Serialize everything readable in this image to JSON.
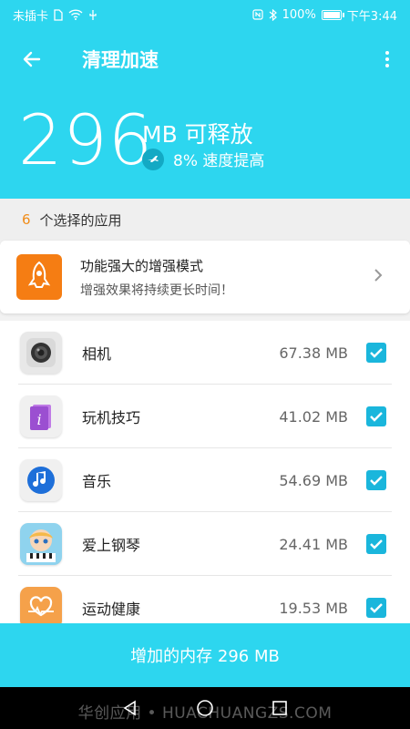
{
  "status_bar": {
    "carrier": "未插卡",
    "battery": "100%",
    "battery_level": 1.0,
    "time": "下午3:44"
  },
  "app_bar": {
    "title": "清理加速",
    "back_icon": "arrow-left-icon",
    "menu_icon": "more-vertical-icon"
  },
  "summary": {
    "amount": "296",
    "unit_label": "MB 可释放",
    "boost_label": "8% 速度提高",
    "boost_icon": "plane-icon"
  },
  "selection": {
    "count": "6",
    "label": "个选择的应用"
  },
  "boost_mode": {
    "title": "功能强大的增强模式",
    "subtitle": "增强效果将持续更长时间！",
    "icon": "rocket-icon",
    "color": "#f57d13"
  },
  "apps": [
    {
      "name": "相机",
      "size": "67.38 MB",
      "checked": true,
      "icon": "camera-icon"
    },
    {
      "name": "玩机技巧",
      "size": "41.02 MB",
      "checked": true,
      "icon": "tips-icon"
    },
    {
      "name": "音乐",
      "size": "54.69 MB",
      "checked": true,
      "icon": "music-icon"
    },
    {
      "name": "爱上钢琴",
      "size": "24.41 MB",
      "checked": true,
      "icon": "piano-game-icon"
    },
    {
      "name": "运动健康",
      "size": "19.53 MB",
      "checked": true,
      "icon": "health-icon"
    }
  ],
  "action_button": {
    "label": "增加的内存 296 MB"
  },
  "watermark": "华创应用 • HUACHUANGZS.COM",
  "colors": {
    "primary": "#2dd6ef",
    "accent": "#f08c18",
    "checkbox": "#1ab6dc"
  }
}
